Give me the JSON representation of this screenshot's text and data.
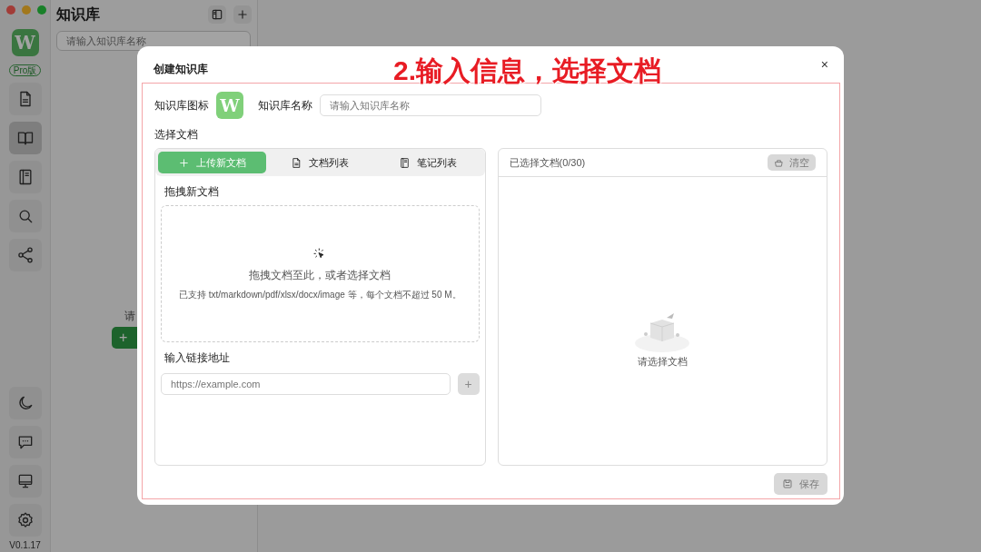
{
  "sidebar": {
    "logo": "W",
    "badge": "Pro版",
    "nav_items": [
      {
        "selected": false
      },
      {
        "selected": true
      },
      {
        "selected": false
      },
      {
        "selected": false
      },
      {
        "selected": false
      }
    ],
    "version": "V0.1.17"
  },
  "list_panel": {
    "title": "知识库",
    "search_placeholder": "请输入知识库名称",
    "empty_text": "请",
    "add_button": "+"
  },
  "modal": {
    "title": "创建知识库",
    "close": "×",
    "annotation": "2.输入信息，选择文档",
    "icon_label": "知识库图标",
    "icon_logo": "W",
    "name_label": "知识库名称",
    "name_placeholder": "请输入知识库名称",
    "section_label": "选择文档",
    "tabs": [
      {
        "label": "上传新文档",
        "selected": true
      },
      {
        "label": "文档列表",
        "selected": false
      },
      {
        "label": "笔记列表",
        "selected": false
      }
    ],
    "drop_title": "拖拽新文档",
    "drop_text": "拖拽文档至此，或者选择文档",
    "drop_hint": "已支持 txt/markdown/pdf/xlsx/docx/image 等，每个文档不超过 50 M。",
    "link_label": "输入链接地址",
    "link_placeholder": "https://example.com",
    "link_add": {
      "label": "+",
      "disabled": true
    },
    "selected_title": "已选择文档(0/30)",
    "clear_button": {
      "label": "清空",
      "disabled": true
    },
    "empty_text": "请选择文档",
    "save_button": {
      "label": "保存",
      "disabled": true
    }
  }
}
